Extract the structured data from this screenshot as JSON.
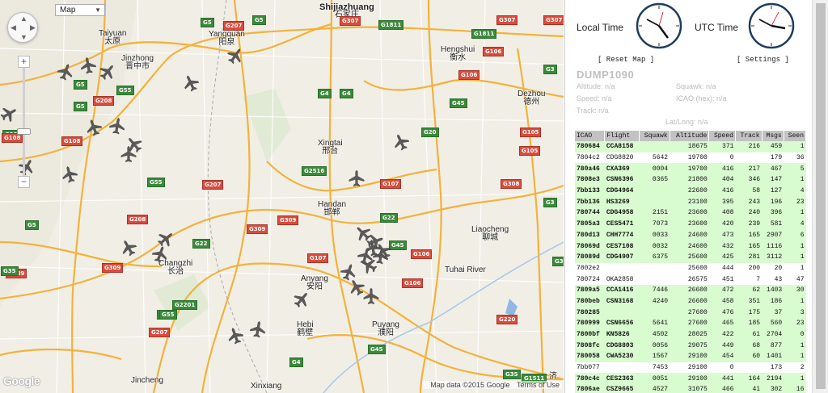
{
  "map": {
    "type_select": "Map",
    "attribution": "Map data ©2015 Google",
    "terms": "Terms of Use",
    "logo": "Google",
    "cities": [
      {
        "name": "Shijiazhuang",
        "cn": "石家庄",
        "major": true
      },
      {
        "name": "Taiyuan",
        "cn": "太原",
        "major": false
      },
      {
        "name": "Yangquan",
        "cn": "阳泉",
        "major": false
      },
      {
        "name": "Jinzhong",
        "cn": "晋中市",
        "major": false
      },
      {
        "name": "Hengshui",
        "cn": "衡水",
        "major": false
      },
      {
        "name": "Dezhou",
        "cn": "德州",
        "major": false
      },
      {
        "name": "Xingtai",
        "cn": "邢台",
        "major": false
      },
      {
        "name": "Handan",
        "cn": "邯郸",
        "major": false
      },
      {
        "name": "Liaocheng",
        "cn": "聊城",
        "major": false
      },
      {
        "name": "Changzhi",
        "cn": "长治",
        "major": false
      },
      {
        "name": "Anyang",
        "cn": "安阳",
        "major": false
      },
      {
        "name": "Hebi",
        "cn": "鹤壁",
        "major": false
      },
      {
        "name": "Puyang",
        "cn": "濮阳",
        "major": false
      },
      {
        "name": "Jincheng",
        "cn": "",
        "major": false
      },
      {
        "name": "Xinxiang",
        "cn": "",
        "major": false
      },
      {
        "name": "济",
        "cn": "",
        "major": false
      },
      {
        "name": "Tuhai River",
        "cn": "",
        "major": false
      }
    ],
    "shields": [
      {
        "code": "G5",
        "red": false
      },
      {
        "code": "G207",
        "red": true
      },
      {
        "code": "G5",
        "red": false
      },
      {
        "code": "G1811",
        "red": false
      },
      {
        "code": "G307",
        "red": true
      },
      {
        "code": "G307",
        "red": true
      },
      {
        "code": "G4",
        "red": false
      },
      {
        "code": "G1811",
        "red": false
      },
      {
        "code": "G106",
        "red": true
      },
      {
        "code": "G106",
        "red": true
      },
      {
        "code": "G3",
        "red": false
      },
      {
        "code": "G45",
        "red": false
      },
      {
        "code": "G20",
        "red": false
      },
      {
        "code": "G105",
        "red": true
      },
      {
        "code": "G105",
        "red": true
      },
      {
        "code": "G55",
        "red": false
      },
      {
        "code": "G208",
        "red": true
      },
      {
        "code": "G5",
        "red": false
      },
      {
        "code": "G20",
        "red": false
      },
      {
        "code": "G108",
        "red": true
      },
      {
        "code": "G55",
        "red": false
      },
      {
        "code": "G2516",
        "red": false
      },
      {
        "code": "G107",
        "red": true
      },
      {
        "code": "G207",
        "red": true
      },
      {
        "code": "G309",
        "red": true
      },
      {
        "code": "G22",
        "red": false
      },
      {
        "code": "G208",
        "red": true
      },
      {
        "code": "G309",
        "red": true
      },
      {
        "code": "G22",
        "red": false
      },
      {
        "code": "G45",
        "red": false
      },
      {
        "code": "G308",
        "red": true
      },
      {
        "code": "G106",
        "red": true
      },
      {
        "code": "G3",
        "red": false
      },
      {
        "code": "G5",
        "red": false
      },
      {
        "code": "G309",
        "red": true
      },
      {
        "code": "G55",
        "red": false
      },
      {
        "code": "G107",
        "red": true
      },
      {
        "code": "G106",
        "red": true
      },
      {
        "code": "G2201",
        "red": false
      },
      {
        "code": "G55",
        "red": false
      },
      {
        "code": "G207",
        "red": true
      },
      {
        "code": "G4",
        "red": false
      },
      {
        "code": "G45",
        "red": false
      },
      {
        "code": "G220",
        "red": true
      },
      {
        "code": "G1511",
        "red": false
      },
      {
        "code": "G35",
        "red": false
      },
      {
        "code": "G309",
        "red": true
      },
      {
        "code": "G5",
        "red": false
      },
      {
        "code": "G4",
        "red": false
      },
      {
        "code": "G35",
        "red": false
      },
      {
        "code": "G307",
        "red": true
      },
      {
        "code": "G108",
        "red": true
      },
      {
        "code": "G3",
        "red": false
      }
    ],
    "planes": 41
  },
  "sidebar": {
    "local_time_label": "Local Time",
    "utc_time_label": "UTC Time",
    "reset_map": "[ Reset Map ]",
    "settings": "[ Settings ]",
    "title": "DUMP1090",
    "altitude": "Altitude: n/a",
    "squawk": "Squawk: n/a",
    "speed": "Speed: n/a",
    "icao": "ICAO (hex): n/a",
    "track": "Track: n/a",
    "latlong": "Lat/Long: n/a"
  },
  "table": {
    "columns": [
      "ICAO",
      "Flight",
      "Squawk",
      "Altitude",
      "Speed",
      "Track",
      "Msgs",
      "Seen"
    ],
    "rows": [
      {
        "icao": "780684",
        "flight": "CCA8158",
        "squawk": "",
        "alt": "18675",
        "speed": "371",
        "track": "216",
        "msgs": "459",
        "seen": "1",
        "pos": true
      },
      {
        "icao": "7804c2",
        "flight": "CDG8820",
        "squawk": "5642",
        "alt": "19700",
        "speed": "0",
        "track": "",
        "msgs": "179",
        "seen": "36",
        "pos": false
      },
      {
        "icao": "780a46",
        "flight": "CXA369",
        "squawk": "0004",
        "alt": "19700",
        "speed": "416",
        "track": "217",
        "msgs": "467",
        "seen": "5",
        "pos": true
      },
      {
        "icao": "7808e3",
        "flight": "CSN6396",
        "squawk": "0365",
        "alt": "21800",
        "speed": "404",
        "track": "346",
        "msgs": "147",
        "seen": "1",
        "pos": true
      },
      {
        "icao": "7bb133",
        "flight": "CDG4964",
        "squawk": "",
        "alt": "22600",
        "speed": "416",
        "track": "58",
        "msgs": "127",
        "seen": "4",
        "pos": true
      },
      {
        "icao": "7bb136",
        "flight": "HS3269",
        "squawk": "",
        "alt": "23100",
        "speed": "395",
        "track": "243",
        "msgs": "196",
        "seen": "23",
        "pos": true
      },
      {
        "icao": "780744",
        "flight": "CDG4958",
        "squawk": "2151",
        "alt": "23600",
        "speed": "408",
        "track": "240",
        "msgs": "396",
        "seen": "1",
        "pos": true
      },
      {
        "icao": "7805a3",
        "flight": "CES5471",
        "squawk": "7073",
        "alt": "23600",
        "speed": "420",
        "track": "239",
        "msgs": "581",
        "seen": "4",
        "pos": true
      },
      {
        "icao": "780d13",
        "flight": "CHH7774",
        "squawk": "0033",
        "alt": "24600",
        "speed": "473",
        "track": "165",
        "msgs": "2907",
        "seen": "6",
        "pos": true
      },
      {
        "icao": "78069d",
        "flight": "CES7108",
        "squawk": "0032",
        "alt": "24600",
        "speed": "432",
        "track": "165",
        "msgs": "1116",
        "seen": "1",
        "pos": true
      },
      {
        "icao": "78089d",
        "flight": "CDG4907",
        "squawk": "6375",
        "alt": "25600",
        "speed": "425",
        "track": "281",
        "msgs": "3112",
        "seen": "1",
        "pos": true
      },
      {
        "icao": "7802e2",
        "flight": "",
        "squawk": "",
        "alt": "25600",
        "speed": "444",
        "track": "200",
        "msgs": "20",
        "seen": "1",
        "pos": false
      },
      {
        "icao": "780724",
        "flight": "OKA2858",
        "squawk": "",
        "alt": "26575",
        "speed": "451",
        "track": "7",
        "msgs": "43",
        "seen": "47",
        "pos": false
      },
      {
        "icao": "7809a5",
        "flight": "CCA1416",
        "squawk": "7446",
        "alt": "26600",
        "speed": "472",
        "track": "62",
        "msgs": "1403",
        "seen": "30",
        "pos": true
      },
      {
        "icao": "780beb",
        "flight": "CSN3168",
        "squawk": "4240",
        "alt": "26600",
        "speed": "458",
        "track": "351",
        "msgs": "186",
        "seen": "1",
        "pos": true
      },
      {
        "icao": "780285",
        "flight": "",
        "squawk": "",
        "alt": "27600",
        "speed": "476",
        "track": "175",
        "msgs": "37",
        "seen": "3",
        "pos": true
      },
      {
        "icao": "780999",
        "flight": "CSN6656",
        "squawk": "5641",
        "alt": "27600",
        "speed": "465",
        "track": "185",
        "msgs": "560",
        "seen": "23",
        "pos": true
      },
      {
        "icao": "7800bf",
        "flight": "KN5826",
        "squawk": "4502",
        "alt": "28025",
        "speed": "422",
        "track": "61",
        "msgs": "2704",
        "seen": "0",
        "pos": true
      },
      {
        "icao": "7808fc",
        "flight": "CDG8803",
        "squawk": "0056",
        "alt": "29075",
        "speed": "449",
        "track": "68",
        "msgs": "877",
        "seen": "1",
        "pos": true
      },
      {
        "icao": "780058",
        "flight": "CWA5230",
        "squawk": "1567",
        "alt": "29100",
        "speed": "454",
        "track": "60",
        "msgs": "1401",
        "seen": "1",
        "pos": true
      },
      {
        "icao": "7bb077",
        "flight": "",
        "squawk": "7453",
        "alt": "29100",
        "speed": "0",
        "track": "",
        "msgs": "173",
        "seen": "2",
        "pos": false
      },
      {
        "icao": "780c4c",
        "flight": "CES2363",
        "squawk": "0051",
        "alt": "29100",
        "speed": "441",
        "track": "164",
        "msgs": "2194",
        "seen": "1",
        "pos": true
      },
      {
        "icao": "7806ae",
        "flight": "CSZ9665",
        "squawk": "4527",
        "alt": "31075",
        "speed": "466",
        "track": "41",
        "msgs": "302",
        "seen": "16",
        "pos": true
      }
    ]
  },
  "colors": {
    "row_with_position": "#d9fbd0",
    "header_bg": "#c2c2c2",
    "expressway": "#f5a623",
    "shield_green": "#3a8a3a",
    "shield_red": "#d94c3d"
  }
}
